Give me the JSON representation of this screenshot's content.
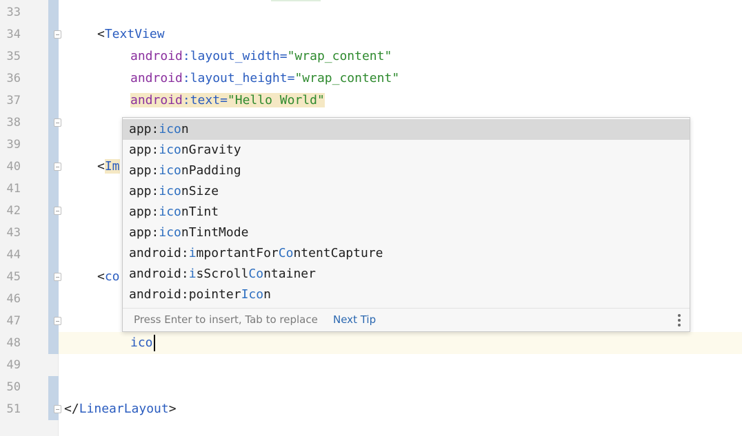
{
  "editor": {
    "line_numbers": [
      "33",
      "34",
      "35",
      "36",
      "37",
      "38",
      "39",
      "40",
      "41",
      "42",
      "43",
      "44",
      "45",
      "46",
      "47",
      "48",
      "49",
      "50",
      "51"
    ],
    "lines": {
      "l34": {
        "open": "<",
        "tag": "TextView"
      },
      "l35": {
        "ns": "android",
        "colon": ":",
        "attr": "layout_width",
        "eq": "=",
        "value": "\"wrap_content\""
      },
      "l36": {
        "ns": "android",
        "colon": ":",
        "attr": "layout_height",
        "eq": "=",
        "value": "\"wrap_content\""
      },
      "l37": {
        "ns": "android",
        "colon": ":",
        "attr": "text",
        "eq": "=",
        "value": "\"Hello World\""
      },
      "l40": {
        "open": "<",
        "tag": "Im"
      },
      "l45": {
        "open": "<",
        "tag": "co"
      },
      "l48": {
        "typed": "ico"
      },
      "l51": {
        "open": "</",
        "tag": "LinearLayout",
        "close": ">"
      }
    }
  },
  "completion": {
    "items": [
      {
        "prefix": "app:",
        "match": "ico",
        "rest": "n"
      },
      {
        "prefix": "app:",
        "match": "ico",
        "rest": "nGravity"
      },
      {
        "prefix": "app:",
        "match": "ico",
        "rest": "nPadding"
      },
      {
        "prefix": "app:",
        "match": "ico",
        "rest": "nSize"
      },
      {
        "prefix": "app:",
        "match": "ico",
        "rest": "nTint"
      },
      {
        "prefix": "app:",
        "match": "ico",
        "rest": "nTintMode"
      },
      {
        "a": "android:",
        "m1": "i",
        "b": "mportantFor",
        "m2": "Co",
        "c": "ntentCapture"
      },
      {
        "a": "android:",
        "m1": "i",
        "b": "sScroll",
        "m2": "Co",
        "c": "ntainer"
      },
      {
        "a": "android:",
        "m1": "",
        "b": "pointer",
        "m2": "Ico",
        "c": "n"
      }
    ],
    "selected_index": 0,
    "footer_hint": "Press Enter to insert, Tab to replace",
    "next_tip": "Next Tip",
    "more_icon": "more-vertical-icon"
  },
  "colors": {
    "tag": "#2a5cbf",
    "namespace": "#8a2f9e",
    "string": "#2e8a2e",
    "match_highlight": "#2e6fc0",
    "selected_row": "#d9d9d9"
  }
}
